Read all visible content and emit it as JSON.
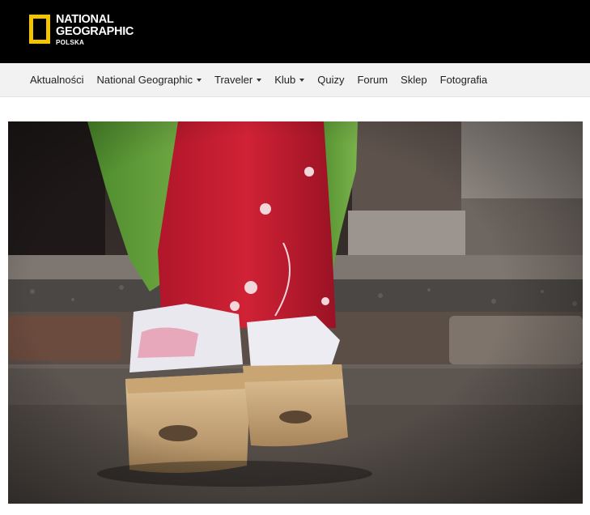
{
  "header": {
    "logo": {
      "line1": "NATIONAL",
      "line2": "GEOGRAPHIC",
      "line3": "POLSKA",
      "frame_color": "#f5c400"
    }
  },
  "nav": {
    "items": [
      {
        "label": "Aktualności",
        "has_dropdown": false
      },
      {
        "label": "National Geographic",
        "has_dropdown": true
      },
      {
        "label": "Traveler",
        "has_dropdown": true
      },
      {
        "label": "Klub",
        "has_dropdown": true
      },
      {
        "label": "Quizy",
        "has_dropdown": false
      },
      {
        "label": "Forum",
        "has_dropdown": false
      },
      {
        "label": "Sklep",
        "has_dropdown": false
      },
      {
        "label": "Fotografia",
        "has_dropdown": false
      }
    ]
  },
  "main": {
    "photo": {
      "subject": "geisha-feet-okobo-sandals",
      "icon": "photo"
    }
  }
}
